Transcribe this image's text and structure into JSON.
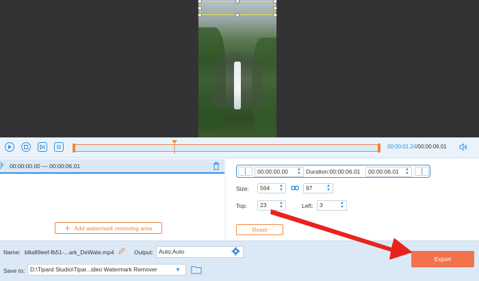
{
  "timeline": {
    "current_time": "00:00:01.24",
    "separator": "/",
    "total_time": "00:00:06.01"
  },
  "segment": {
    "start": "00:00:00.00",
    "dash": "—",
    "end": "00:00:06.01"
  },
  "add_area_label": "Add watermark removing area",
  "area": {
    "start_time": "00:00:00.00",
    "duration_label": "Duration:",
    "duration_value": "00:00:06.01",
    "end_time": "00:00:06.01",
    "bracket_open": "[",
    "bracket_close": "]",
    "size_label": "Size:",
    "width": "564",
    "height": "97",
    "top_label": "Top:",
    "top": "23",
    "left_label": "Left:",
    "left": "3",
    "reset_label": "Reset"
  },
  "output_bar": {
    "name_label": "Name:",
    "file_name": "b8a89eef-fb51-...ark_DeWate.mp4",
    "output_label": "Output:",
    "output_value": "Auto;Auto",
    "save_label": "Save to:",
    "save_path": "D:\\Tipard Studio\\Tipar...ideo Watermark Remover",
    "export_label": "Export"
  },
  "colors": {
    "accent_blue": "#2f8ee0",
    "accent_orange": "#f1853b",
    "export_button": "#f1724c",
    "annotation_arrow": "#e8231c"
  }
}
